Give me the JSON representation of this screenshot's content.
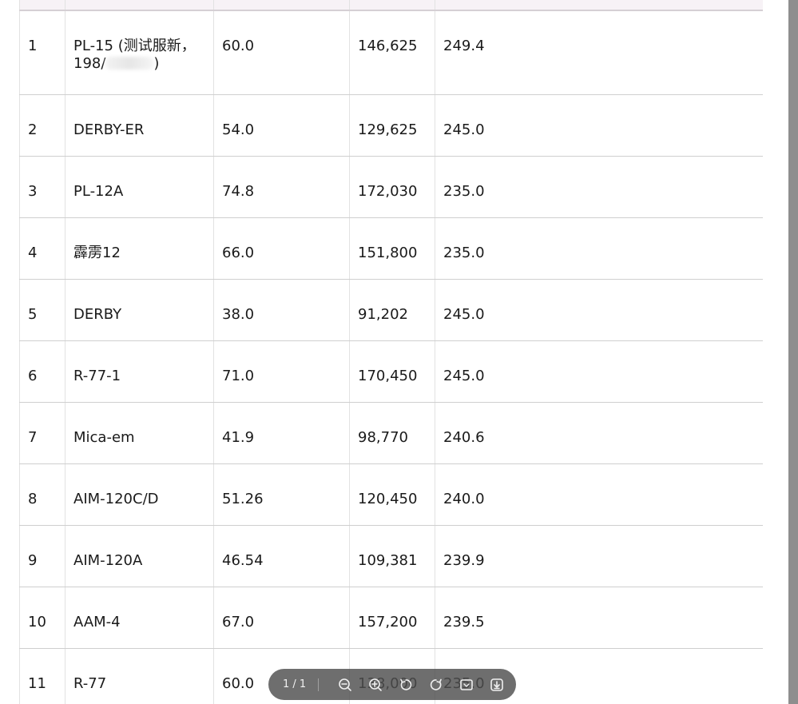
{
  "table": {
    "rows": [
      {
        "rank": "1",
        "name": "PL-15 (测试服新，",
        "name2": "198/",
        "name2_suffix": ")",
        "c3": "60.0",
        "c4": "146,625",
        "c5": "249.4"
      },
      {
        "rank": "2",
        "name": "DERBY-ER",
        "c3": "54.0",
        "c4": "129,625",
        "c5": "245.0"
      },
      {
        "rank": "3",
        "name": "PL-12A",
        "c3": "74.8",
        "c4": "172,030",
        "c5": "235.0"
      },
      {
        "rank": "4",
        "name": "霹雳12",
        "c3": "66.0",
        "c4": "151,800",
        "c5": "235.0"
      },
      {
        "rank": "5",
        "name": "DERBY",
        "c3": "38.0",
        "c4": "91,202",
        "c5": "245.0"
      },
      {
        "rank": "6",
        "name": "R-77-1",
        "c3": "71.0",
        "c4": "170,450",
        "c5": "245.0"
      },
      {
        "rank": "7",
        "name": "Mica-em",
        "c3": "41.9",
        "c4": "98,770",
        "c5": "240.6"
      },
      {
        "rank": "8",
        "name": "AIM-120C/D",
        "c3": "51.26",
        "c4": "120,450",
        "c5": "240.0"
      },
      {
        "rank": "9",
        "name": "AIM-120A",
        "c3": "46.54",
        "c4": "109,381",
        "c5": "239.9"
      },
      {
        "rank": "10",
        "name": "AAM-4",
        "c3": "67.0",
        "c4": "157,200",
        "c5": "239.5"
      },
      {
        "rank": "11",
        "name": "R-77",
        "c3": "60.0",
        "c4": "138,000",
        "c5": "235.0"
      }
    ]
  },
  "toolbar": {
    "page_indicator": "1 / 1",
    "icons": [
      "zoom-out-icon",
      "zoom-in-icon",
      "rotate-left-icon",
      "rotate-right-icon",
      "fit-page-icon",
      "download-icon"
    ],
    "background": "#4e4e4e"
  }
}
